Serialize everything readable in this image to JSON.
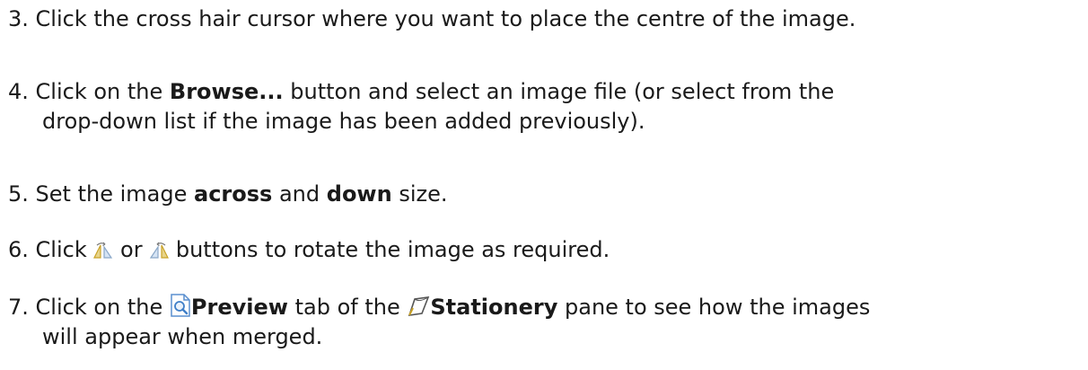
{
  "steps": [
    {
      "number": "3.",
      "text": "Click the cross hair cursor where you want to place the centre of the image."
    },
    {
      "number": "4.",
      "text_before": "Click on the",
      "bold": "Browse...",
      "text_after_line1": "button and select an image file (or select from the",
      "text_line2": "drop-down list if the image has been added previously)."
    },
    {
      "number": "5.",
      "text_before": "Set the image",
      "bold1": "across",
      "text_mid": "and",
      "bold2": "down",
      "text_after": "size."
    },
    {
      "number": "6.",
      "text_before": "Click",
      "icon1": "rotate-left-icon",
      "text_mid": "or",
      "icon2": "rotate-right-icon",
      "text_after": "buttons to rotate the image as required."
    },
    {
      "number": "7.",
      "text_before": "Click on the",
      "icon1": "preview-icon",
      "bold1": "Preview",
      "text_mid": "tab of the",
      "icon2": "stationery-icon",
      "bold2": "Stationery",
      "text_after_line1": "pane to see how the images",
      "text_line2": "will appear when merged."
    }
  ],
  "colors": {
    "text": "#1a1a1a",
    "icon_gold": "#c9a227",
    "icon_blue": "#3f7fc8"
  }
}
